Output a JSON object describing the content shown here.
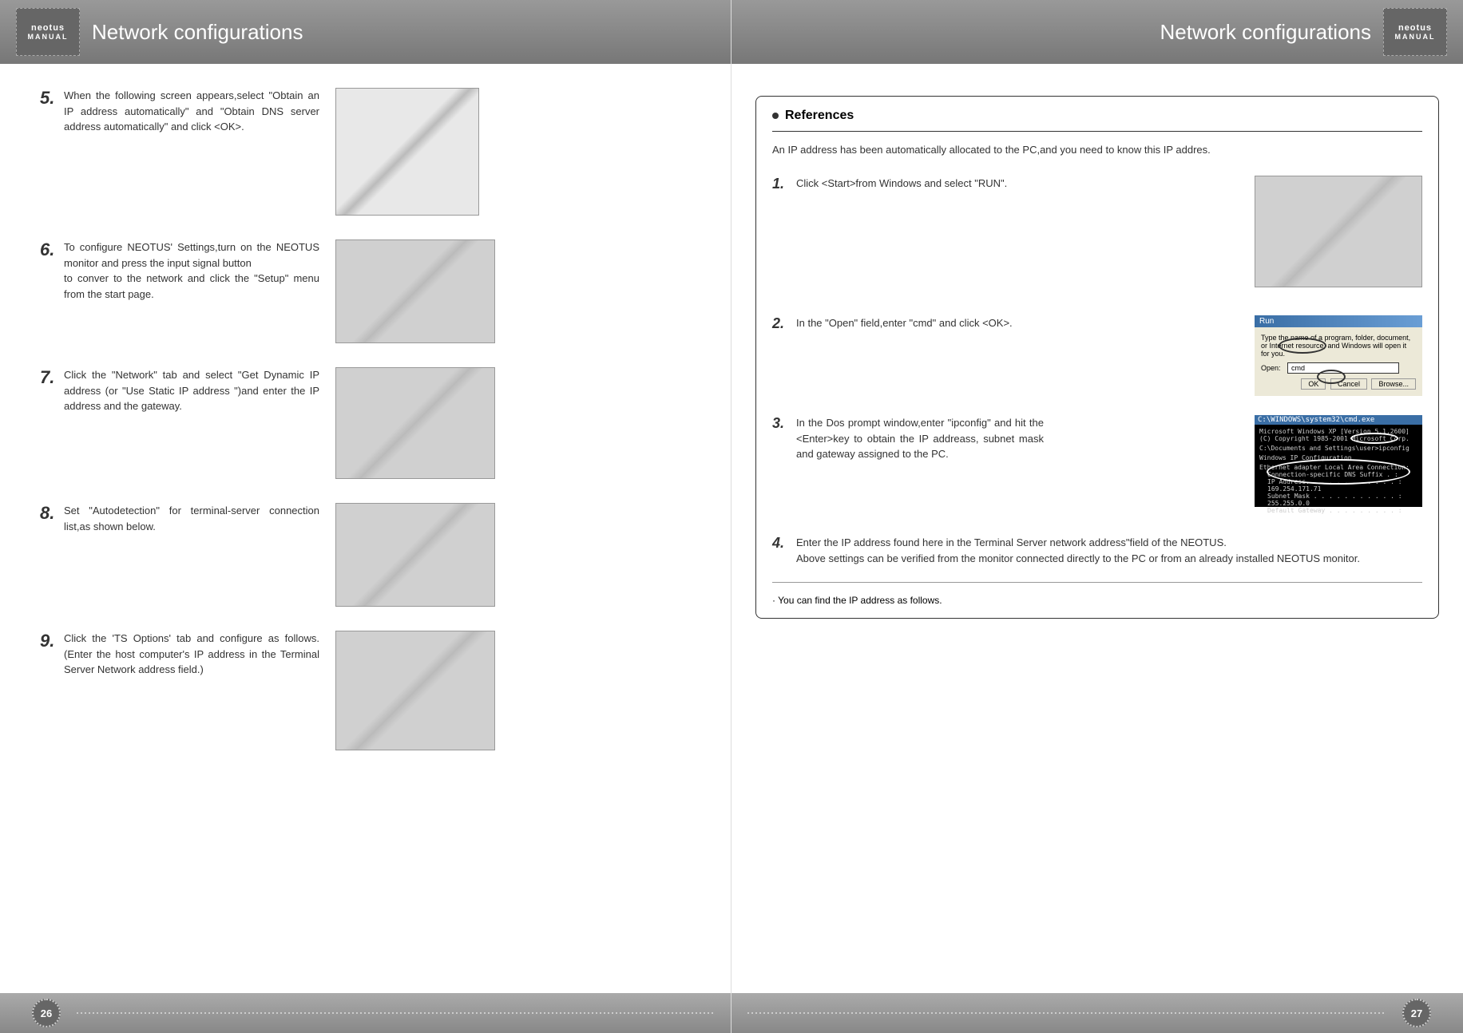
{
  "header": {
    "title_left": "Network configurations",
    "title_right": "Network configurations",
    "logo_top": "neotus",
    "logo_bottom": "MANUAL"
  },
  "left_page": {
    "steps": [
      {
        "num": "5.",
        "text": "When the following screen appears,select \"Obtain an IP address automatically\" and \"Obtain DNS server address automatically\" and click <OK>."
      },
      {
        "num": "6.",
        "text": "To configure NEOTUS' Settings,turn on the NEOTUS monitor and press the input signal button\nto conver to the network and click the \"Setup\" menu from the start page."
      },
      {
        "num": "7.",
        "text": "Click the \"Network\" tab and select \"Get Dynamic IP address (or \"Use Static IP address \")and enter the IP address and the gateway."
      },
      {
        "num": "8.",
        "text": "Set \"Autodetection\" for terminal-server connection list,as shown below."
      },
      {
        "num": "9.",
        "text": "Click the 'TS Options' tab and configure as follows.(Enter the host computer's IP address in the Terminal Server Network address field.)"
      }
    ],
    "page_number": "26"
  },
  "right_page": {
    "references_title": "References",
    "intro": "An IP address has been automatically allocated to the PC,and you need to know this IP addres.",
    "steps": [
      {
        "num": "1.",
        "text": "Click <Start>from Windows and select \"RUN\"."
      },
      {
        "num": "2.",
        "text": "In the \"Open\" field,enter \"cmd\" and click <OK>."
      },
      {
        "num": "3.",
        "text": "In the Dos prompt window,enter \"ipconfig\" and hit the <Enter>key to obtain the IP addreass, subnet mask and gateway assigned to the PC."
      },
      {
        "num": "4.",
        "text": "Enter the IP address found here in the Terminal Server network address\"field of the NEOTUS.\nAbove settings can be verified from the monitor connected directly to the PC or from an already installed NEOTUS monitor."
      }
    ],
    "note": "You can find the IP address as follows.",
    "page_number": "27",
    "run_dialog": {
      "title": "Run",
      "desc": "Type the name of a program, folder, document, or Internet resource, and Windows will open it for you.",
      "open_label": "Open:",
      "open_value": "cmd",
      "ok": "OK",
      "cancel": "Cancel",
      "browse": "Browse..."
    },
    "cmd": {
      "title": "C:\\WINDOWS\\system32\\cmd.exe",
      "line1": "Microsoft Windows XP [Version 5.1.2600]",
      "line2": "(C) Copyright 1985-2001 Microsoft Corp.",
      "line3": "C:\\Documents and Settings\\user>ipconfig",
      "line4": "Windows IP Configuration",
      "line5": "Ethernet adapter Local Area Connection:",
      "line6": "Connection-specific DNS Suffix . :",
      "line7": "IP Address. . . . . . . . . . . . : 169.254.171.71",
      "line8": "Subnet Mask . . . . . . . . . . . : 255.255.0.0",
      "line9": "Default Gateway . . . . . . . . . :"
    }
  }
}
